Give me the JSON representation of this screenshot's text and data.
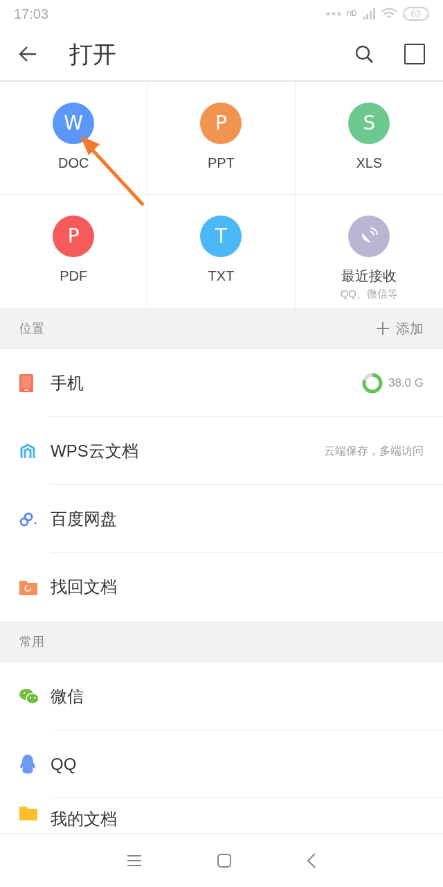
{
  "status_bar": {
    "time": "17:03",
    "network": "HD",
    "battery": "63"
  },
  "header": {
    "title": "打开"
  },
  "file_types": [
    {
      "label": "DOC",
      "glyph": "W",
      "color": "#5b97f7"
    },
    {
      "label": "PPT",
      "glyph": "P",
      "color": "#f39350"
    },
    {
      "label": "XLS",
      "glyph": "S",
      "color": "#6cc88c"
    },
    {
      "label": "PDF",
      "glyph": "P",
      "color": "#f65b5b"
    },
    {
      "label": "TXT",
      "glyph": "T",
      "color": "#4cb8f8"
    },
    {
      "label": "最近接收",
      "sublabel": "QQ、微信等",
      "color": "#b7b5d2",
      "kind": "recent"
    }
  ],
  "locations": {
    "title": "位置",
    "add_label": "添加",
    "items": [
      {
        "kind": "phone",
        "label": "手机",
        "storage": {
          "level": 0.8,
          "reading": "38.0 G"
        }
      },
      {
        "kind": "cloud",
        "label": "WPS云文档",
        "hint": "云端保存，多端访问"
      },
      {
        "kind": "baidu",
        "label": "百度网盘"
      },
      {
        "kind": "recover",
        "label": "找回文档"
      }
    ]
  },
  "common": {
    "title": "常用",
    "items": [
      {
        "kind": "wechat",
        "label": "微信"
      },
      {
        "kind": "qq",
        "label": "QQ"
      },
      {
        "kind": "folder",
        "label": "我的文档"
      }
    ]
  }
}
